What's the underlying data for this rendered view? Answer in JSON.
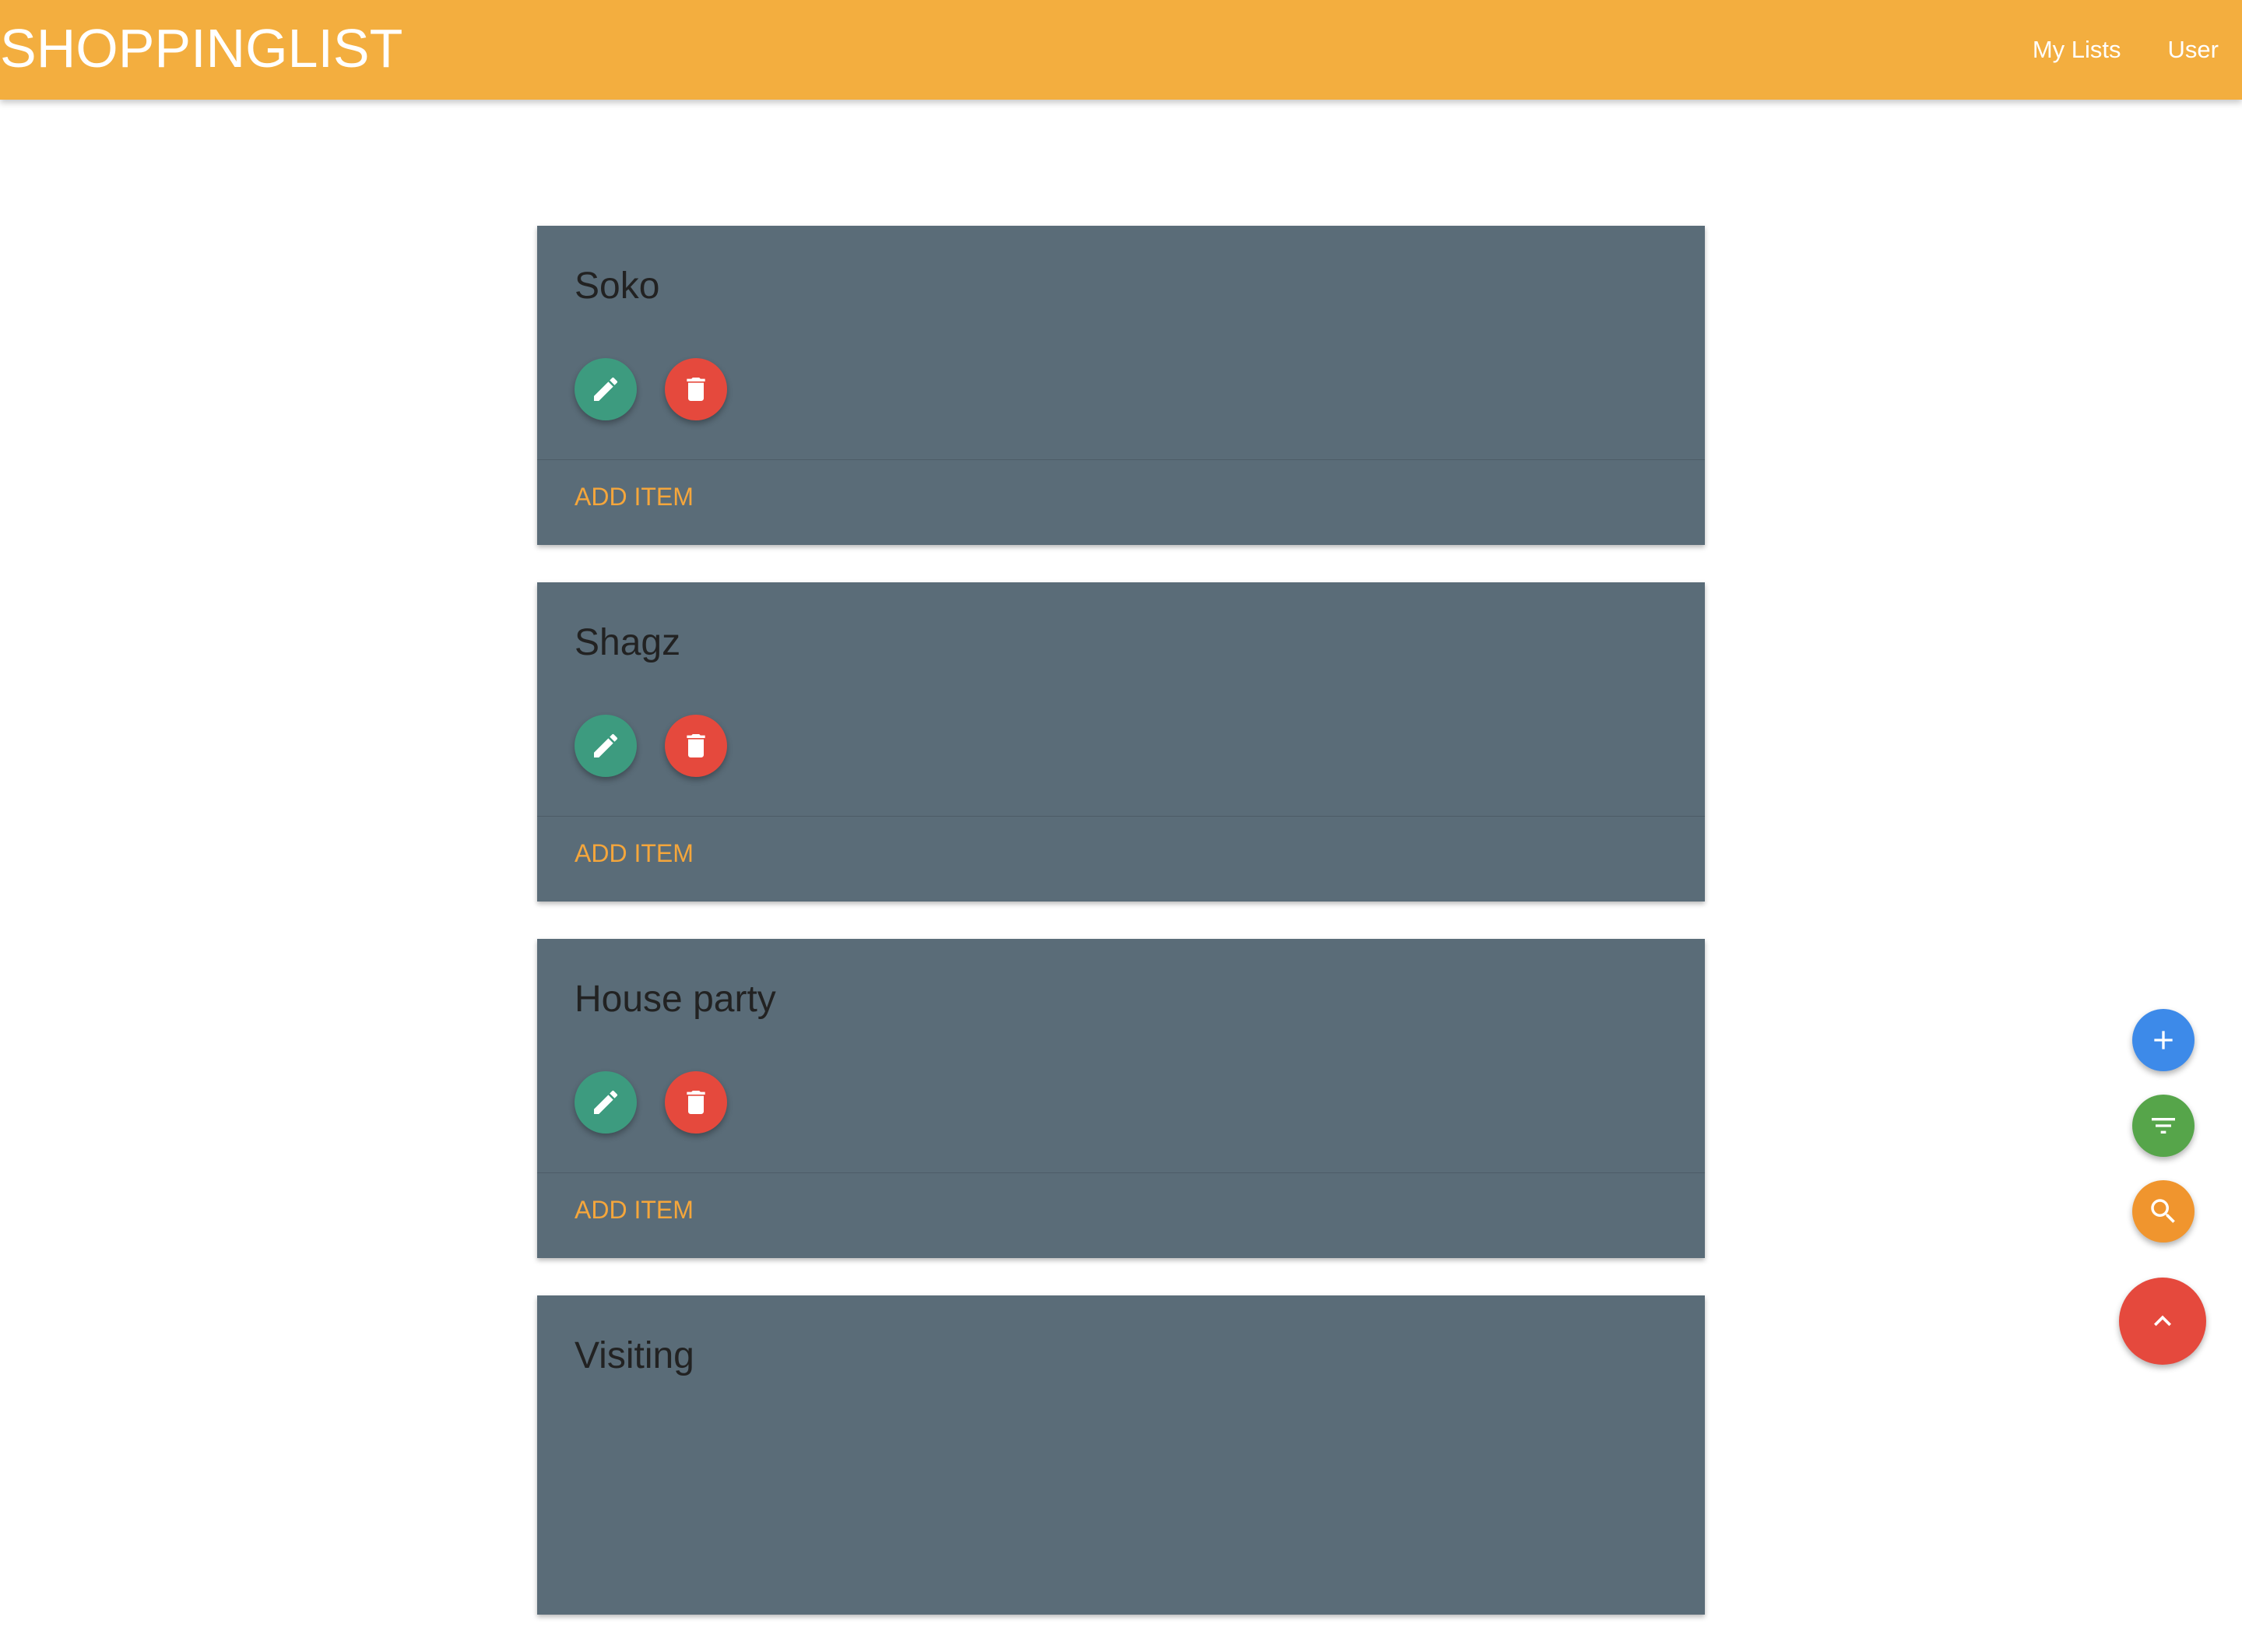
{
  "navbar": {
    "brand": "SHOPPINGLIST",
    "links": [
      {
        "label": "My Lists"
      },
      {
        "label": "User"
      }
    ],
    "background_color": "#f3ae3f"
  },
  "lists": [
    {
      "title": "Soko",
      "action_label": "ADD ITEM"
    },
    {
      "title": "Shagz",
      "action_label": "ADD ITEM"
    },
    {
      "title": "House party",
      "action_label": "ADD ITEM"
    },
    {
      "title": "Visiting",
      "action_label": ""
    }
  ],
  "card_buttons": {
    "edit_icon": "pencil-icon",
    "delete_icon": "trash-icon",
    "edit_color": "#3d9b7f",
    "delete_color": "#e5493d"
  },
  "floating_actions": [
    {
      "name": "add",
      "icon": "plus-icon",
      "color": "#3d8ae9"
    },
    {
      "name": "filter",
      "icon": "filter-icon",
      "color": "#56a54a"
    },
    {
      "name": "search",
      "icon": "search-icon",
      "color": "#f0952e"
    },
    {
      "name": "scroll-top",
      "icon": "chevron-up-icon",
      "color": "#e5493d"
    }
  ],
  "colors": {
    "card_background": "#5a6c78",
    "action_text": "#f5a63b"
  }
}
